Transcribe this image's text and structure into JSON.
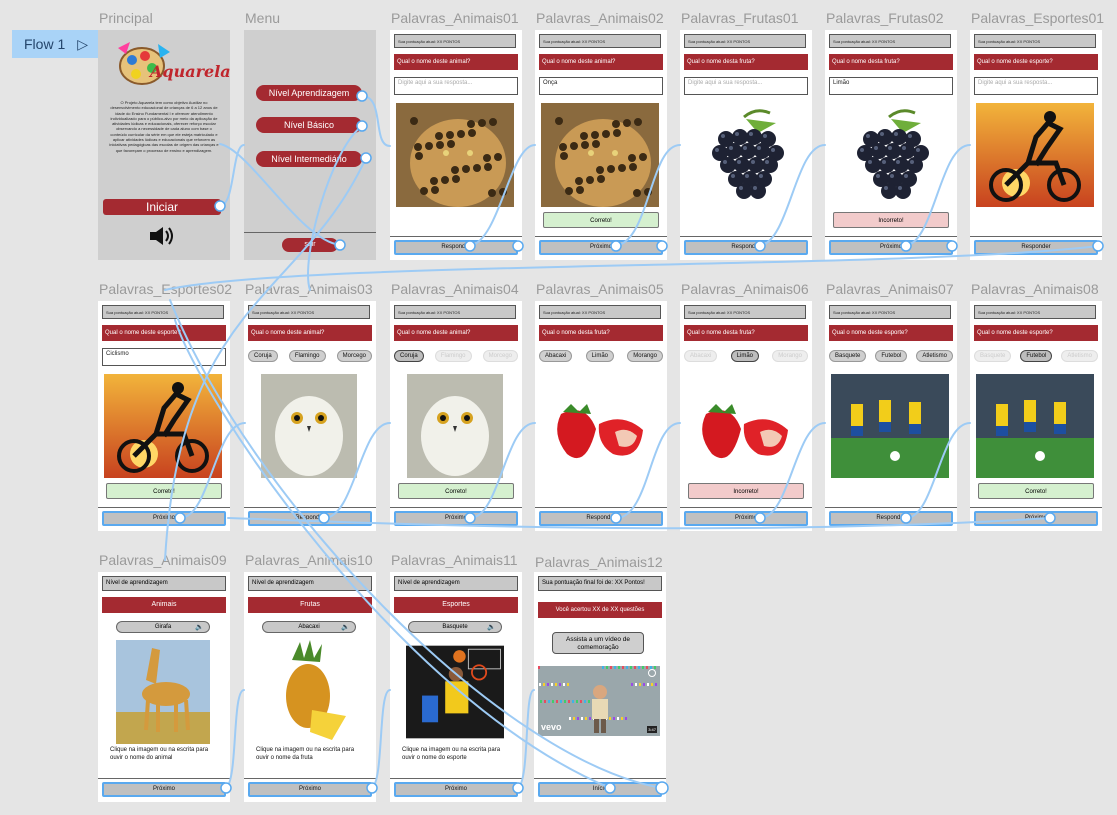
{
  "flow": {
    "label": "Flow 1",
    "play_icon": "play-icon"
  },
  "colors": {
    "accent": "#a42a31",
    "wire": "#9dcbf5",
    "ok": "#d5f0cf",
    "bad": "#f2cbcb"
  },
  "frames": {
    "principal": {
      "title": "Principal",
      "logo_text": "Aquarela",
      "description": "O Projeto Aquarela tem como objetivo Auxiliar no desenvolvimento educacional de crianças de 6 a 12 anos de idade do Ensino Fundamental I e oferecer atendimento individualizado para o público-alvo por meio da aplicação de atividades lúdicas e educacionais, oferecer reforço escolar observando a necessidade de cada aluno com base o conteúdo curricular da série em que ele esteja matriculado e aplicar atividades lúdicas e educacionais que reforcem as iniciativas pedagógicas das escolas de origem das crianças e que favoreçam o processo de ensino e aprendizagem.",
      "start_label": "Iniciar"
    },
    "menu": {
      "title": "Menu",
      "items": [
        "Nível Aprendizagem",
        "Nível Básico",
        "Nível Intermediário"
      ],
      "exit_label": "sair"
    },
    "r1": [
      {
        "title": "Palavras_Animais01",
        "score": "Sua pontuação atual: XX PONTOS",
        "question": "Qual o nome deste animal?",
        "answer": "Digite aqui a sua resposta...",
        "answer_placeholder": true,
        "image": "jaguar",
        "feedback": "",
        "button": "Responder"
      },
      {
        "title": "Palavras_Animais02",
        "score": "Sua pontuação atual: XX PONTOS",
        "question": "Qual o nome deste animal?",
        "answer": "Onça",
        "answer_placeholder": false,
        "image": "jaguar",
        "feedback": "Correto!",
        "feedback_type": "ok",
        "button": "Próximo"
      },
      {
        "title": "Palavras_Frutas01",
        "score": "Sua pontuação atual: XX PONTOS",
        "question": "Qual o nome desta fruta?",
        "answer": "Digite aqui a sua resposta...",
        "answer_placeholder": true,
        "image": "grapes",
        "feedback": "",
        "button": "Responder"
      },
      {
        "title": "Palavras_Frutas02",
        "score": "Sua pontuação atual: XX PONTOS",
        "question": "Qual o nome desta fruta?",
        "answer": "Limão",
        "answer_placeholder": false,
        "image": "grapes",
        "feedback": "Incorreto!",
        "feedback_type": "bad",
        "button": "Próximo"
      },
      {
        "title": "Palavras_Esportes01",
        "score": "Sua pontuação atual: XX PONTOS",
        "question": "Qual o nome deste esporte?",
        "answer": "Digite aqui a sua resposta...",
        "answer_placeholder": true,
        "image": "cyclist",
        "feedback": "",
        "button": "Responder"
      }
    ],
    "r2": [
      {
        "title": "Palavras_Esportes02",
        "score": "Sua pontuação atual: XX PONTOS",
        "question": "Qual o nome deste esporte?",
        "answer": "Ciclismo",
        "image": "cyclist",
        "feedback": "Correto!",
        "feedback_type": "ok",
        "button": "Próximo"
      },
      {
        "title": "Palavras_Animais03",
        "score": "Sua pontuação atual: XX PONTOS",
        "question": "Qual o nome deste animal?",
        "options": [
          "Coruja",
          "Flamingo",
          "Morcego"
        ],
        "image": "owl",
        "feedback": "",
        "button": "Responder"
      },
      {
        "title": "Palavras_Animais04",
        "score": "Sua pontuação atual: XX PONTOS",
        "question": "Qual o nome deste animal?",
        "options": [
          "Coruja",
          "Flamingo",
          "Morcego"
        ],
        "selected": 0,
        "image": "owl",
        "feedback": "Correto!",
        "feedback_type": "ok",
        "button": "Próximo"
      },
      {
        "title": "Palavras_Animais05",
        "score": "Sua pontuação atual: XX PONTOS",
        "question": "Qual o nome desta fruta?",
        "options": [
          "Abacaxi",
          "Limão",
          "Morango"
        ],
        "image": "strawberry",
        "feedback": "",
        "button": "Responder"
      },
      {
        "title": "Palavras_Animais06",
        "score": "Sua pontuação atual: XX PONTOS",
        "question": "Qual o nome desta fruta?",
        "options": [
          "Abacaxi",
          "Limão",
          "Morango"
        ],
        "selected": 1,
        "image": "strawberry",
        "feedback": "Incorreto!",
        "feedback_type": "bad",
        "button": "Próximo"
      },
      {
        "title": "Palavras_Animais07",
        "score": "Sua pontuação atual: XX PONTOS",
        "question": "Qual o nome deste esporte?",
        "options": [
          "Basquete",
          "Futebol",
          "Atletismo"
        ],
        "image": "soccer",
        "feedback": "",
        "button": "Responder"
      },
      {
        "title": "Palavras_Animais08",
        "score": "Sua pontuação atual: XX PONTOS",
        "question": "Qual o nome deste esporte?",
        "options": [
          "Basquete",
          "Futebol",
          "Atletismo"
        ],
        "selected": 1,
        "image": "soccer",
        "feedback": "Correto!",
        "feedback_type": "ok",
        "button": "Próximo"
      }
    ],
    "r3": [
      {
        "title": "Palavras_Animais09",
        "header": "Nível de aprendizagem",
        "category": "Animais",
        "word": "Girafa",
        "image": "giraffe",
        "hint": "Clique na imagem ou na escrita para ouvir o nome do animal",
        "button": "Próximo"
      },
      {
        "title": "Palavras_Animais10",
        "header": "Nível de aprendizagem",
        "category": "Frutas",
        "word": "Abacaxi",
        "image": "pineapple",
        "hint": "Clique na imagem ou na escrita para ouvir o nome da fruta",
        "button": "Próximo"
      },
      {
        "title": "Palavras_Animais11",
        "header": "Nível de aprendizagem",
        "category": "Esportes",
        "word": "Basquete",
        "image": "basketball",
        "hint": "Clique na imagem ou na escrita para ouvir o nome do esporte",
        "button": "Próximo"
      }
    ],
    "final": {
      "title": "Palavras_Animais12",
      "header": "Sua pontuação final foi de: XX Pontos!",
      "result": "Você acertou XX de XX questões",
      "video_button": "Assista a um vídeo de comemoração",
      "video_brand": "vevo",
      "video_time": "3:47",
      "button": "Início"
    }
  }
}
